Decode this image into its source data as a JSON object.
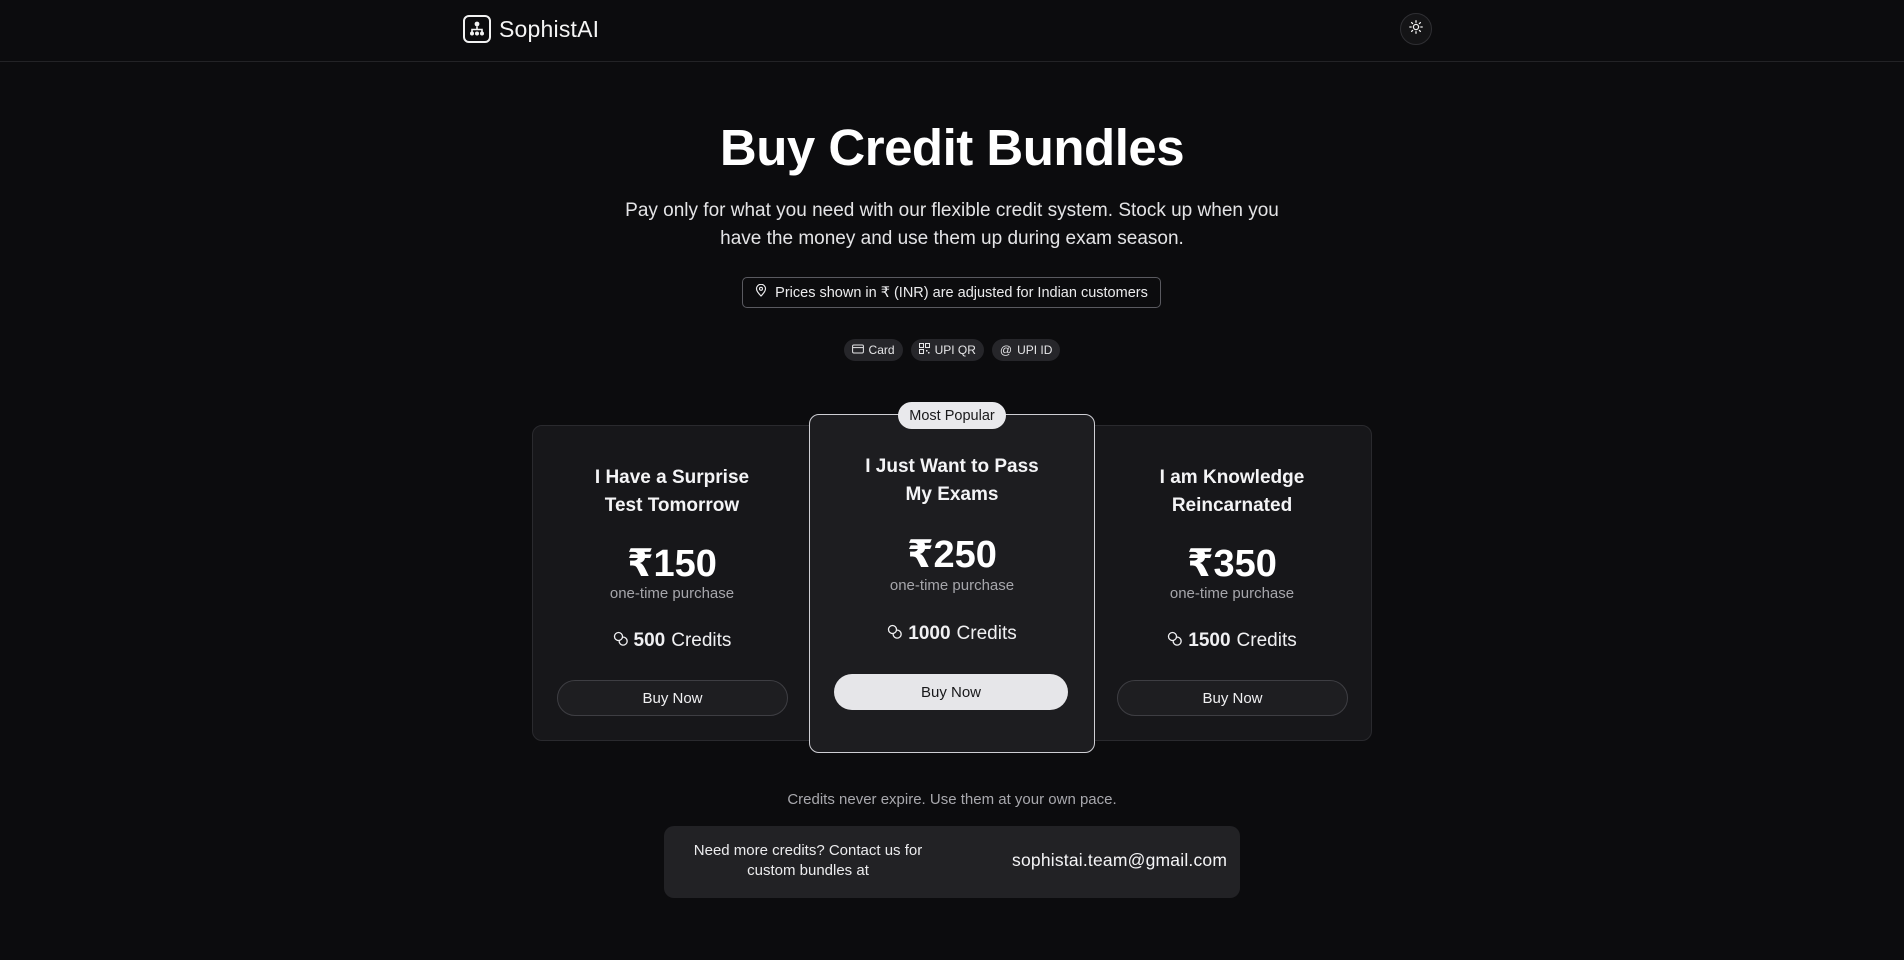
{
  "header": {
    "brand_name": "SophistAI",
    "brand_icon": "org-chart-icon",
    "theme_toggle_icon": "sun-icon"
  },
  "hero": {
    "title": "Buy Credit Bundles",
    "subtitle": "Pay only for what you need with our flexible credit system. Stock up when you have the money and use them up during exam season.",
    "region_notice": "Prices shown in ₹ (INR) are adjusted for Indian customers",
    "region_icon": "map-pin-icon"
  },
  "payment_methods": [
    {
      "label": "Card",
      "icon": "credit-card-icon"
    },
    {
      "label": "UPI QR",
      "icon": "qr-code-icon"
    },
    {
      "label": "UPI ID",
      "icon": "at-sign-icon"
    }
  ],
  "plans": [
    {
      "name": "I Have a Surprise Test Tomorrow",
      "price": "₹150",
      "price_note": "one-time purchase",
      "credits_amount": "500",
      "credits_label": "Credits",
      "button_label": "Buy Now",
      "featured": false
    },
    {
      "name": "I Just Want to Pass My Exams",
      "price": "₹250",
      "price_note": "one-time purchase",
      "credits_amount": "1000",
      "credits_label": "Credits",
      "button_label": "Buy Now",
      "featured": true,
      "badge": "Most Popular"
    },
    {
      "name": "I am Knowledge Reincarnated",
      "price": "₹350",
      "price_note": "one-time purchase",
      "credits_amount": "1500",
      "credits_label": "Credits",
      "button_label": "Buy Now",
      "featured": false
    }
  ],
  "footer": {
    "note": "Credits never expire. Use them at your own pace.",
    "contact_text": "Need more credits? Contact us for custom bundles at",
    "contact_email": "sophistai.team@gmail.com"
  },
  "colors": {
    "background": "#0c0c0e",
    "card": "#17171a",
    "featured_card": "#1d1d20",
    "accent_button": "#e6e6e9"
  }
}
